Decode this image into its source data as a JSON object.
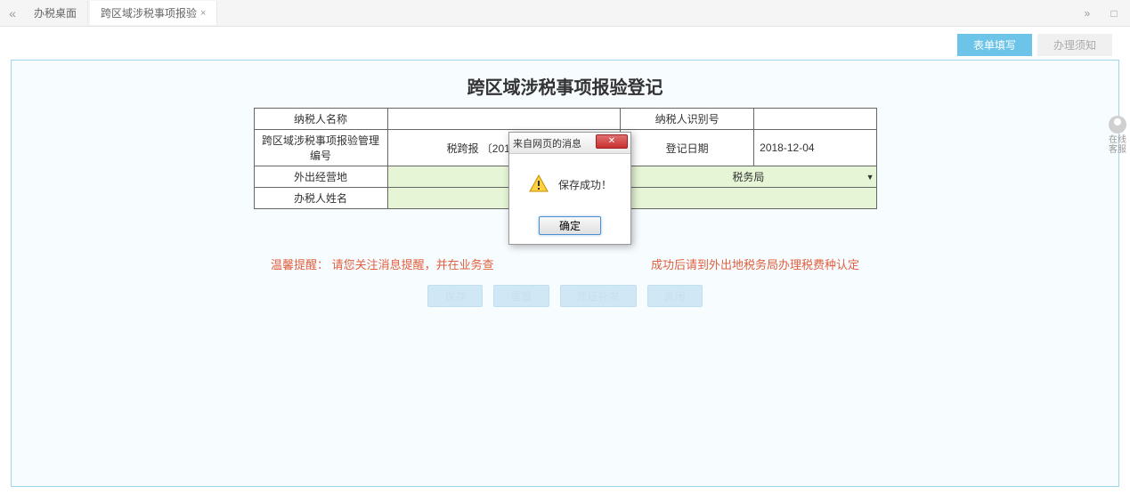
{
  "tabs": {
    "tab1": "办税桌面",
    "tab2": "跨区域涉税事项报验"
  },
  "subTabs": {
    "active": "表单填写",
    "inactive": "办理须知"
  },
  "form": {
    "title": "跨区域涉税事项报验登记",
    "labels": {
      "taxpayer_name": "纳税人名称",
      "taxpayer_id": "纳税人识别号",
      "mgmt_no": "跨区域涉税事项报验管理编号",
      "reg_date": "登记日期",
      "out_place": "外出经营地",
      "handler": "办税人姓名"
    },
    "values": {
      "taxpayer_name": "",
      "taxpayer_id": "",
      "mgmt_no": "税跨报 〔2018〕 468 号",
      "reg_date": "2018-12-04",
      "out_place": "",
      "tax_bureau": "税务局",
      "handler": ""
    }
  },
  "reminder": "温馨提醒： 请您关注消息提醒，并在业务查询中查看业务办理状态。报验成功后请到外出地税务局办理税费种认定",
  "reminder_left": "温馨提醒： 请您关注消息提醒，并在业务查",
  "reminder_right": "成功后请到外出地税务局办理税费种认定",
  "buttons": {
    "save": "保存",
    "reset": "重置",
    "cert": "凭证补发",
    "close": "关闭"
  },
  "modal": {
    "title": "来自网页的消息",
    "message": "保存成功！",
    "ok": "确定"
  },
  "sideWidget": {
    "line1": "在线",
    "line2": "客服"
  }
}
